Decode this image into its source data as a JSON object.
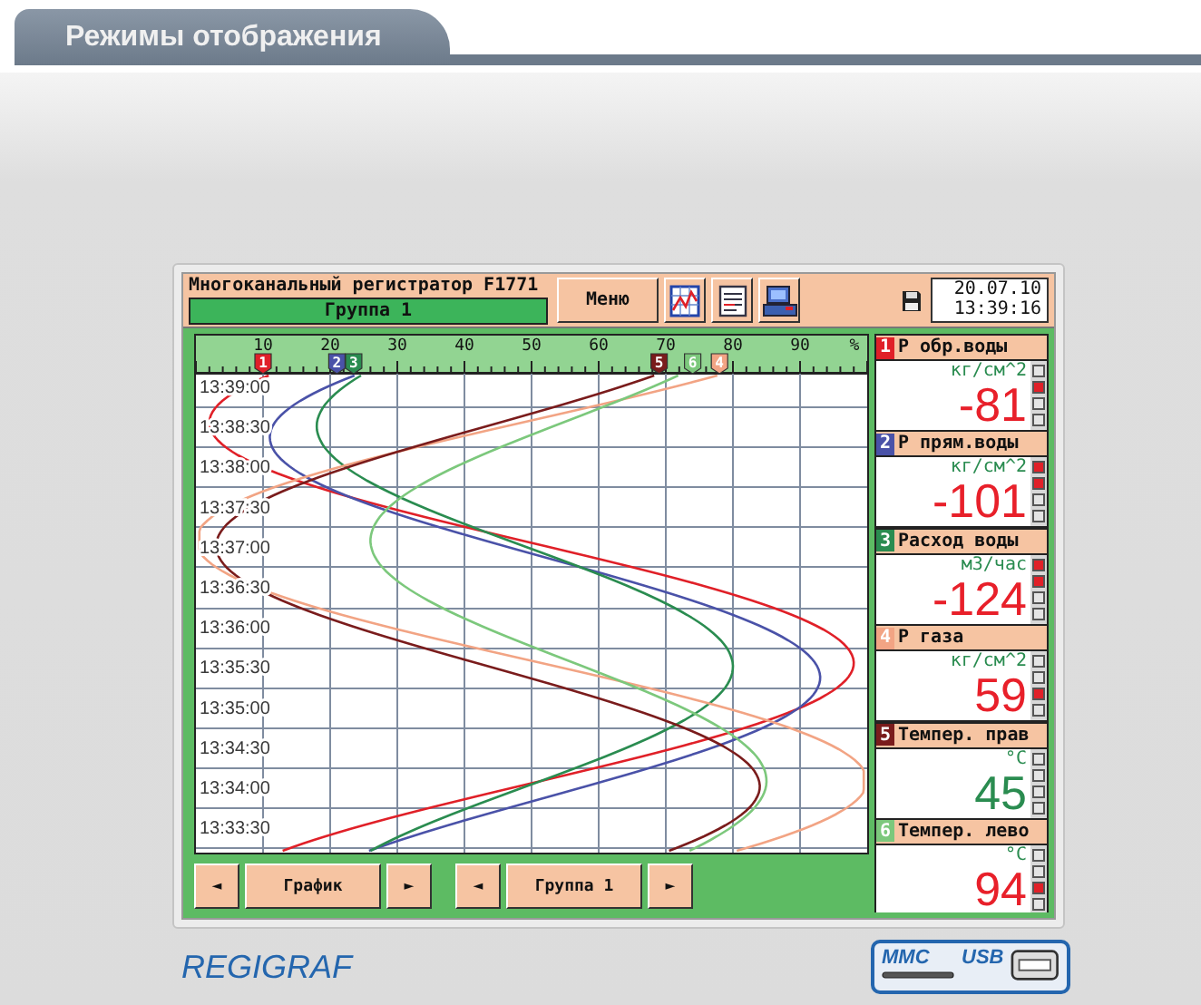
{
  "header_tab": {
    "title": "Режимы отображения"
  },
  "screen": {
    "title": "Многоканальный регистратор F1771",
    "group": "Группа 1",
    "menu_button": "Меню",
    "date": "20.07.10",
    "time": "13:39:16",
    "chart": {
      "scale_labels": [
        "10",
        "20",
        "30",
        "40",
        "50",
        "60",
        "70",
        "80",
        "90"
      ],
      "unit": "%",
      "time_labels": [
        "13:39:00",
        "13:38:30",
        "13:38:00",
        "13:37:30",
        "13:37:00",
        "13:36:30",
        "13:36:00",
        "13:35:30",
        "13:35:00",
        "13:34:30",
        "13:34:00",
        "13:33:30"
      ]
    },
    "markers": [
      {
        "label": "1",
        "level": 0.1,
        "color": "#e02028"
      },
      {
        "label": "2",
        "level": 0.21,
        "color": "#4a52a8"
      },
      {
        "label": "3",
        "level": 0.235,
        "color": "#2a8c50"
      },
      {
        "label": "5",
        "level": 0.69,
        "color": "#7a1c1c"
      },
      {
        "label": "6",
        "level": 0.74,
        "color": "#7cc87c"
      },
      {
        "label": "4",
        "level": 0.78,
        "color": "#f2a484"
      }
    ],
    "channels": [
      {
        "number": "1",
        "name": "Р обр.воды",
        "unit": "кг/см^2",
        "value": "-81",
        "color": "#e02028",
        "alarms": [
          false,
          true,
          false,
          false
        ]
      },
      {
        "number": "2",
        "name": "Р прям.воды",
        "unit": "кг/см^2",
        "value": "-101",
        "color": "#4a52a8",
        "alarms": [
          true,
          true,
          false,
          false
        ]
      },
      {
        "number": "3",
        "name": "Расход воды",
        "unit": "м3/час",
        "value": "-124",
        "color": "#2a8c50",
        "alarms": [
          true,
          true,
          false,
          false
        ]
      },
      {
        "number": "4",
        "name": "Р газа",
        "unit": "кг/см^2",
        "value": "59",
        "color": "#f2a484",
        "alarms": [
          false,
          false,
          true,
          false
        ]
      },
      {
        "number": "5",
        "name": "Темпер. прав",
        "unit": "°С",
        "value": "45",
        "color": "#7a1c1c",
        "alarms": [
          false,
          false,
          false,
          false
        ]
      },
      {
        "number": "6",
        "name": "Темпер. лево",
        "unit": "°С",
        "value": "94",
        "color": "#7cc87c",
        "alarms": [
          false,
          false,
          true,
          false
        ]
      }
    ],
    "selectors": [
      {
        "prev": "◄",
        "label": "График",
        "next": "►"
      },
      {
        "prev": "◄",
        "label": "Группа 1",
        "next": "►"
      }
    ]
  },
  "footer": {
    "brand": "REGIGRAF",
    "card_label": "MMC",
    "usb_label": "USB"
  }
}
